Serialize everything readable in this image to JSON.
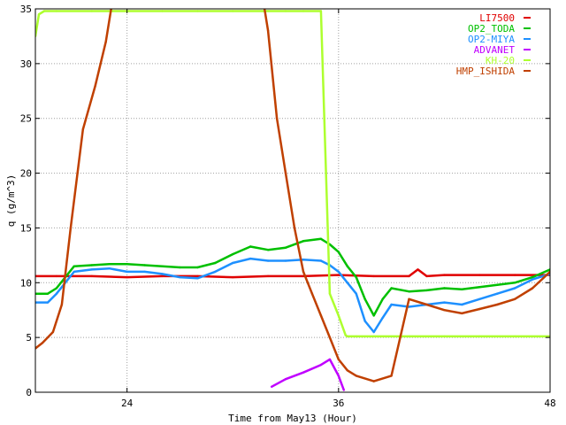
{
  "chart_data": {
    "type": "line",
    "xlabel": "Time from May13 (Hour)",
    "ylabel": "q (g/m^3)",
    "xlim": [
      18.8,
      48
    ],
    "ylim": [
      0,
      35
    ],
    "x_ticks": [
      24,
      36,
      48
    ],
    "y_ticks": [
      0,
      5,
      10,
      15,
      20,
      25,
      30,
      35
    ],
    "grid": "dotted",
    "legend_position": "top-right",
    "series": [
      {
        "name": "LI7500",
        "color": "#e00000",
        "x": [
          18.8,
          20,
          22,
          24,
          26,
          28,
          30,
          32,
          34,
          36,
          38,
          40,
          40.5,
          41,
          42,
          44,
          46,
          48
        ],
        "y": [
          10.6,
          10.6,
          10.6,
          10.5,
          10.6,
          10.6,
          10.5,
          10.6,
          10.6,
          10.7,
          10.6,
          10.6,
          11.2,
          10.6,
          10.7,
          10.7,
          10.7,
          10.7
        ]
      },
      {
        "name": "OP2_TODA",
        "color": "#00c000",
        "x": [
          18.8,
          19.5,
          20,
          21,
          22,
          23,
          24,
          25,
          26,
          27,
          28,
          29,
          30,
          31,
          32,
          33,
          34,
          35,
          35.5,
          36,
          36.5,
          37,
          37.5,
          38,
          38.5,
          39,
          40,
          41,
          42,
          43,
          44,
          45,
          46,
          47,
          48
        ],
        "y": [
          9.0,
          9.0,
          9.5,
          11.5,
          11.6,
          11.7,
          11.7,
          11.6,
          11.5,
          11.4,
          11.4,
          11.8,
          12.6,
          13.3,
          13.0,
          13.2,
          13.8,
          14.0,
          13.5,
          12.8,
          11.5,
          10.5,
          8.5,
          7.0,
          8.5,
          9.5,
          9.2,
          9.3,
          9.5,
          9.4,
          9.6,
          9.8,
          10.0,
          10.5,
          11.2
        ]
      },
      {
        "name": "OP2-MIYA",
        "color": "#1e90ff",
        "x": [
          18.8,
          19.5,
          20,
          21,
          22,
          23,
          24,
          25,
          26,
          27,
          28,
          29,
          30,
          31,
          32,
          33,
          34,
          35,
          35.5,
          36,
          36.5,
          37,
          37.5,
          38,
          38.5,
          39,
          40,
          41,
          42,
          43,
          44,
          45,
          46,
          47,
          48
        ],
        "y": [
          8.2,
          8.2,
          9.0,
          11.0,
          11.2,
          11.3,
          11.0,
          11.0,
          10.8,
          10.5,
          10.4,
          11.0,
          11.8,
          12.2,
          12.0,
          12.0,
          12.1,
          12.0,
          11.6,
          11.0,
          10.0,
          9.0,
          6.5,
          5.5,
          6.8,
          8.0,
          7.8,
          8.0,
          8.2,
          8.0,
          8.5,
          9.0,
          9.5,
          10.3,
          10.8
        ]
      },
      {
        "name": "ADVANET",
        "color": "#c000ff",
        "x": [
          32.2,
          33,
          34,
          35,
          35.5,
          36,
          36.3
        ],
        "y": [
          0.5,
          1.2,
          1.8,
          2.5,
          3.0,
          1.5,
          0.2
        ]
      },
      {
        "name": "KH-20",
        "color": "#adff2f",
        "x": [
          18.8,
          19.0,
          19.3,
          20,
          22,
          24,
          26,
          28,
          30,
          32,
          33,
          34,
          35,
          35.5,
          36,
          36.4,
          36.5,
          37,
          38,
          40,
          42,
          44,
          46,
          48
        ],
        "y": [
          32.5,
          34.5,
          34.8,
          34.8,
          34.8,
          34.8,
          34.8,
          34.8,
          34.8,
          34.8,
          34.8,
          34.8,
          34.8,
          9.0,
          7.0,
          5.2,
          5.1,
          5.1,
          5.1,
          5.1,
          5.1,
          5.1,
          5.1,
          5.1
        ]
      },
      {
        "name": "HMP_ISHIDA",
        "color": "#c04000",
        "x": [
          18.8,
          19.2,
          19.8,
          20.3,
          20.8,
          21.5,
          22.2,
          22.8,
          23.2,
          24.5,
          31.7,
          32,
          32.5,
          33,
          33.5,
          34,
          34.5,
          35,
          35.5,
          36,
          36.5,
          37,
          38,
          39,
          40,
          41,
          42,
          43,
          44,
          45,
          46,
          47,
          48
        ],
        "y": [
          4.0,
          4.5,
          5.5,
          8.0,
          15.0,
          24.0,
          28.0,
          32.0,
          36.0,
          36.0,
          36.0,
          33.0,
          25.0,
          20.0,
          15.0,
          11.0,
          9.0,
          7.0,
          5.0,
          3.0,
          2.0,
          1.5,
          1.0,
          1.5,
          8.5,
          8.0,
          7.5,
          7.2,
          7.6,
          8.0,
          8.5,
          9.5,
          11.0
        ]
      }
    ]
  }
}
